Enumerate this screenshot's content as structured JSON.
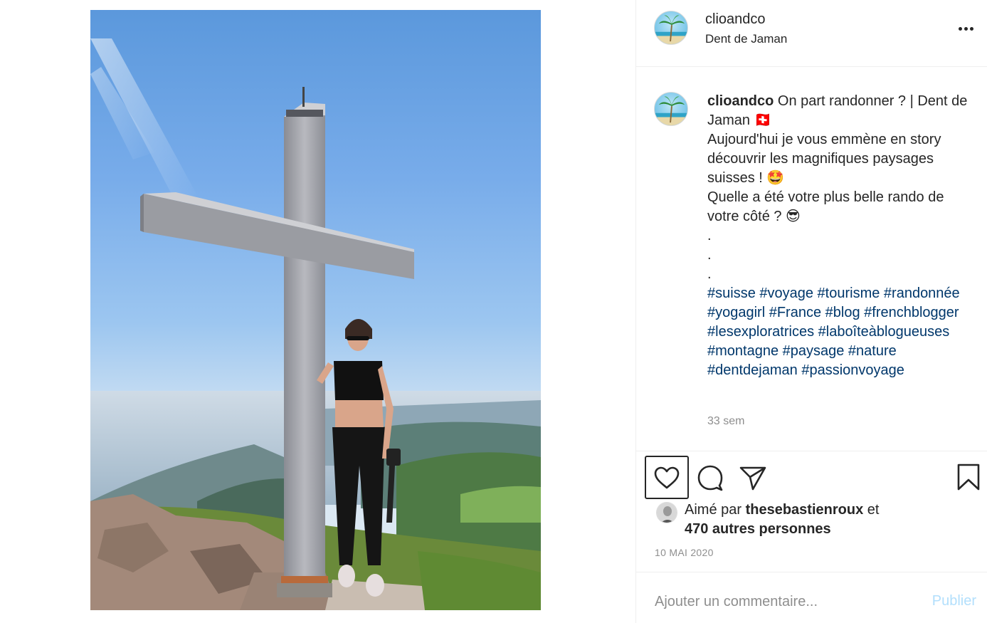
{
  "post": {
    "username": "clioandco",
    "location": "Dent de Jaman"
  },
  "caption": {
    "username": "clioandco",
    "text": " On part randonner ? | Dent de Jaman 🇨🇭\nAujourd'hui je vous emmène en story découvrir les magnifiques paysages suisses ! 🤩\nQuelle a été votre plus belle rando de votre côté ? 😎\n.\n.\n.",
    "hashtags": "#suisse #voyage #tourisme #randonnée #yogagirl #France #blog #frenchblogger #lesexploratrices #laboîteàblogueuses #montagne #paysage #nature #dentdejaman #passionvoyage",
    "time_ago": "33 sem"
  },
  "likes": {
    "prefix": "Aimé par ",
    "liker": "thesebastienroux",
    "middle": " et",
    "others": "470 autres personnes"
  },
  "date": "10 MAI 2020",
  "comment_box": {
    "placeholder": "Ajouter un commentaire...",
    "publish_label": "Publier"
  },
  "colors": {
    "text": "#262626",
    "secondary": "#8e8e8e",
    "hashtag": "#00376b",
    "publish_disabled": "#b2dffc",
    "border": "#efefef"
  },
  "icons": {
    "like": "heart-icon",
    "comment": "comment-bubble-icon",
    "share": "paper-plane-icon",
    "save": "bookmark-icon",
    "more": "more-options-icon"
  }
}
